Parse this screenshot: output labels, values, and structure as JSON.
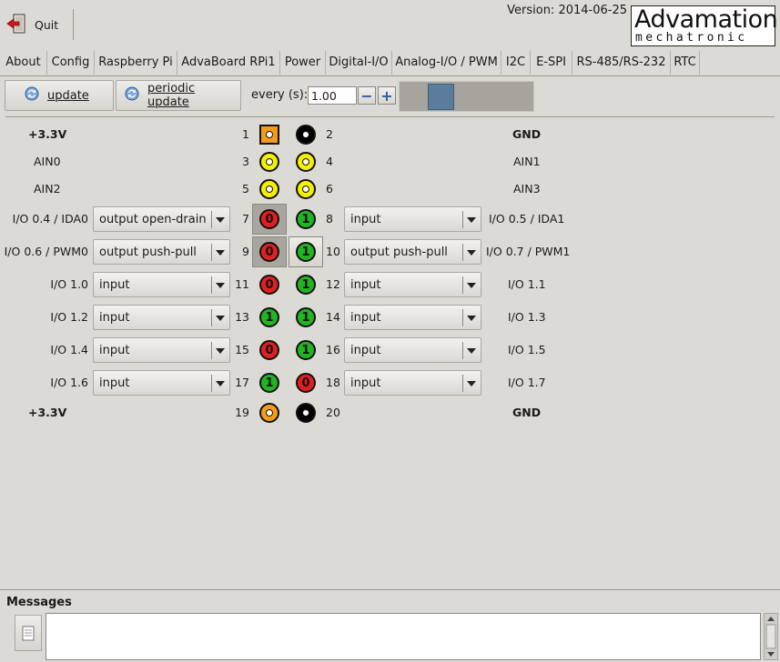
{
  "toolbar": {
    "quit_label": "Quit",
    "version": "Version: 2014-06-25"
  },
  "logo": {
    "line1": "Advamation",
    "line2": "mechatronic"
  },
  "tabs": [
    "About",
    "Config",
    "Raspberry Pi",
    "AdvaBoard RPi1",
    "Power",
    "Digital-I/O",
    "Analog-I/O / PWM",
    "I2C",
    "E-SPI",
    "RS-485/RS-232",
    "RTC"
  ],
  "active_tab": "Digital-I/O",
  "controls": {
    "update_label": "update",
    "periodic_label": "periodic update",
    "every_label": "every (s):",
    "every_value": "1.00",
    "minus": "−",
    "plus": "+"
  },
  "pins": {
    "left_labels": [
      "+3.3V",
      "AIN0",
      "AIN2",
      "I/O 0.4 / IDA0",
      "I/O 0.6 / PWM0",
      "I/O 1.0",
      "I/O 1.2",
      "I/O 1.4",
      "I/O 1.6",
      "+3.3V"
    ],
    "right_labels": [
      "GND",
      "AIN1",
      "AIN3",
      "I/O 0.5 / IDA1",
      "I/O 0.7 / PWM1",
      "I/O 1.1",
      "I/O 1.3",
      "I/O 1.5",
      "I/O 1.7",
      "GND"
    ],
    "left_nums": [
      "1",
      "3",
      "5",
      "7",
      "9",
      "11",
      "13",
      "15",
      "17",
      "19"
    ],
    "right_nums": [
      "2",
      "4",
      "6",
      "8",
      "10",
      "12",
      "14",
      "16",
      "18",
      "20"
    ],
    "left_modes": [
      "",
      "",
      "",
      "output open-drain",
      "output push-pull",
      "input",
      "input",
      "input",
      "input",
      ""
    ],
    "right_modes": [
      "",
      "",
      "",
      "input",
      "output push-pull",
      "input",
      "input",
      "input",
      "input",
      ""
    ],
    "left_states": [
      "",
      "",
      "",
      "0",
      "0",
      "0",
      "1",
      "0",
      "1",
      ""
    ],
    "right_states": [
      "",
      "",
      "",
      "1",
      "1",
      "1",
      "1",
      "1",
      "0",
      ""
    ]
  },
  "colors": {
    "power": "#f59b1a",
    "gnd": "#000000",
    "analog": "#f5ef00",
    "low": "#e02020",
    "high": "#22b422",
    "selected": "#a9a69f"
  },
  "messages": {
    "title": "Messages"
  }
}
